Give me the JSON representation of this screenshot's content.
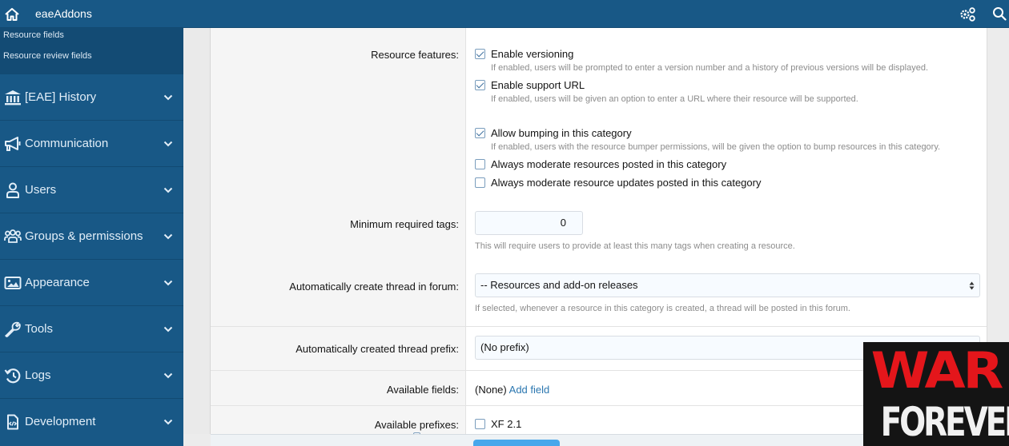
{
  "topbar": {
    "title": "eaeAddons",
    "icons": [
      "home-icon",
      "gear-icon",
      "search-icon"
    ]
  },
  "sidebar": {
    "sub_items": [
      {
        "label": "Resource fields"
      },
      {
        "label": "Resource review fields"
      }
    ],
    "items": [
      {
        "label": "[EAE] History",
        "icon": "bank-icon"
      },
      {
        "label": "Communication",
        "icon": "megaphone-icon"
      },
      {
        "label": "Users",
        "icon": "user-icon"
      },
      {
        "label": "Groups & permissions",
        "icon": "users-icon"
      },
      {
        "label": "Appearance",
        "icon": "image-icon"
      },
      {
        "label": "Tools",
        "icon": "wrench-icon"
      },
      {
        "label": "Logs",
        "icon": "history-icon"
      },
      {
        "label": "Development",
        "icon": "code-file-icon"
      }
    ]
  },
  "form": {
    "resource_features": {
      "label": "Resource features:",
      "options": [
        {
          "label": "Enable versioning",
          "checked": true,
          "hint": "If enabled, users will be prompted to enter a version number and a history of previous versions will be displayed."
        },
        {
          "label": "Enable support URL",
          "checked": true,
          "hint": "If enabled, users will be given an option to enter a URL where their resource will be supported."
        },
        {
          "label": "Allow bumping in this category",
          "checked": true,
          "hint": "If enabled, users with the resource bumper permissions, will be given the option to bump resources in this category."
        },
        {
          "label": "Always moderate resources posted in this category",
          "checked": false
        },
        {
          "label": "Always moderate resource updates posted in this category",
          "checked": false
        }
      ]
    },
    "min_tags": {
      "label": "Minimum required tags:",
      "value": "0",
      "hint": "This will require users to provide at least this many tags when creating a resource."
    },
    "thread_forum": {
      "label": "Automatically create thread in forum:",
      "selected": "-- Resources and add-on releases",
      "hint": "If selected, whenever a resource in this category is created, a thread will be posted in this forum."
    },
    "thread_prefix": {
      "label": "Automatically created thread prefix:",
      "selected": "(No prefix)"
    },
    "available_fields": {
      "label": "Available fields:",
      "value": "(None)",
      "link": "Add field"
    },
    "available_prefixes": {
      "label": "Available prefixes:",
      "options": [
        {
          "label": "XF 2.1",
          "checked": false
        }
      ]
    }
  },
  "overlay": {
    "line1": "WAR",
    "line2": "FOREVER"
  }
}
